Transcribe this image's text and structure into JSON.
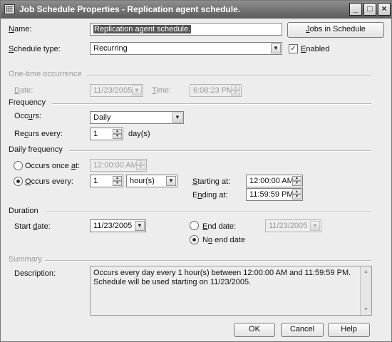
{
  "window": {
    "title": "Job Schedule Properties - Replication agent schedule.",
    "icon": "calendar-grid-icon",
    "controls": {
      "minimize": "_",
      "maximize": "□",
      "close": "×"
    }
  },
  "name": {
    "label_pre": "",
    "label_u": "N",
    "label_post": "ame:",
    "value": "Replication agent schedule."
  },
  "jobs_button": {
    "pre": "",
    "u": "J",
    "post": "obs in Schedule"
  },
  "schedule_type": {
    "label_pre": "",
    "label_u": "S",
    "label_post": "chedule type:",
    "value": "Recurring"
  },
  "enabled": {
    "pre": "",
    "u": "E",
    "post": "nabled",
    "checked": true,
    "mark": "✓"
  },
  "one_time": {
    "heading": "One-time occurrence",
    "date_label_pre": "",
    "date_label_u": "D",
    "date_label_post": "ate:",
    "date_value": "11/23/2005",
    "time_label_pre": "",
    "time_label_u": "T",
    "time_label_post": "ime:",
    "time_value": "6:08:23 PM"
  },
  "frequency": {
    "heading": "Frequency",
    "occurs_label_pre": "Occ",
    "occurs_label_u": "u",
    "occurs_label_post": "rs:",
    "occurs_value": "Daily",
    "recurs_label_pre": "Re",
    "recurs_label_u": "c",
    "recurs_label_post": "urs every:",
    "recurs_value": "1",
    "recurs_unit": "day(s)"
  },
  "daily_frequency": {
    "heading": "Daily frequency",
    "once_pre": "Occurs once ",
    "once_u": "a",
    "once_post": "t:",
    "once_value": "12:00:00 AM",
    "once_selected": false,
    "every_pre": "",
    "every_u": "O",
    "every_post": "ccurs every:",
    "every_value": "1",
    "every_unit": "hour(s)",
    "every_selected": true,
    "starting_pre": "",
    "starting_u": "S",
    "starting_post": "tarting at:",
    "starting_value": "12:00:00 AM",
    "ending_pre": "E",
    "ending_u": "n",
    "ending_post": "ding at:",
    "ending_value": "11:59:59 PM"
  },
  "duration": {
    "heading": "Duration",
    "start_pre": "Start ",
    "start_u": "d",
    "start_post": "ate:",
    "start_value": "11/23/2005",
    "end_pre": "",
    "end_u": "E",
    "end_post": "nd date:",
    "end_value": "11/23/2005",
    "end_selected": false,
    "noend_pre": "N",
    "noend_u": "o",
    "noend_post": " end date",
    "noend_selected": true
  },
  "summary": {
    "heading": "Summary",
    "description_label": "Description:",
    "description": "Occurs every day every 1 hour(s) between 12:00:00 AM and 11:59:59 PM. Schedule will be used starting on 11/23/2005."
  },
  "buttons": {
    "ok": "OK",
    "cancel": "Cancel",
    "help": "Help"
  },
  "arrows": {
    "down": "▼",
    "up": "▲"
  }
}
